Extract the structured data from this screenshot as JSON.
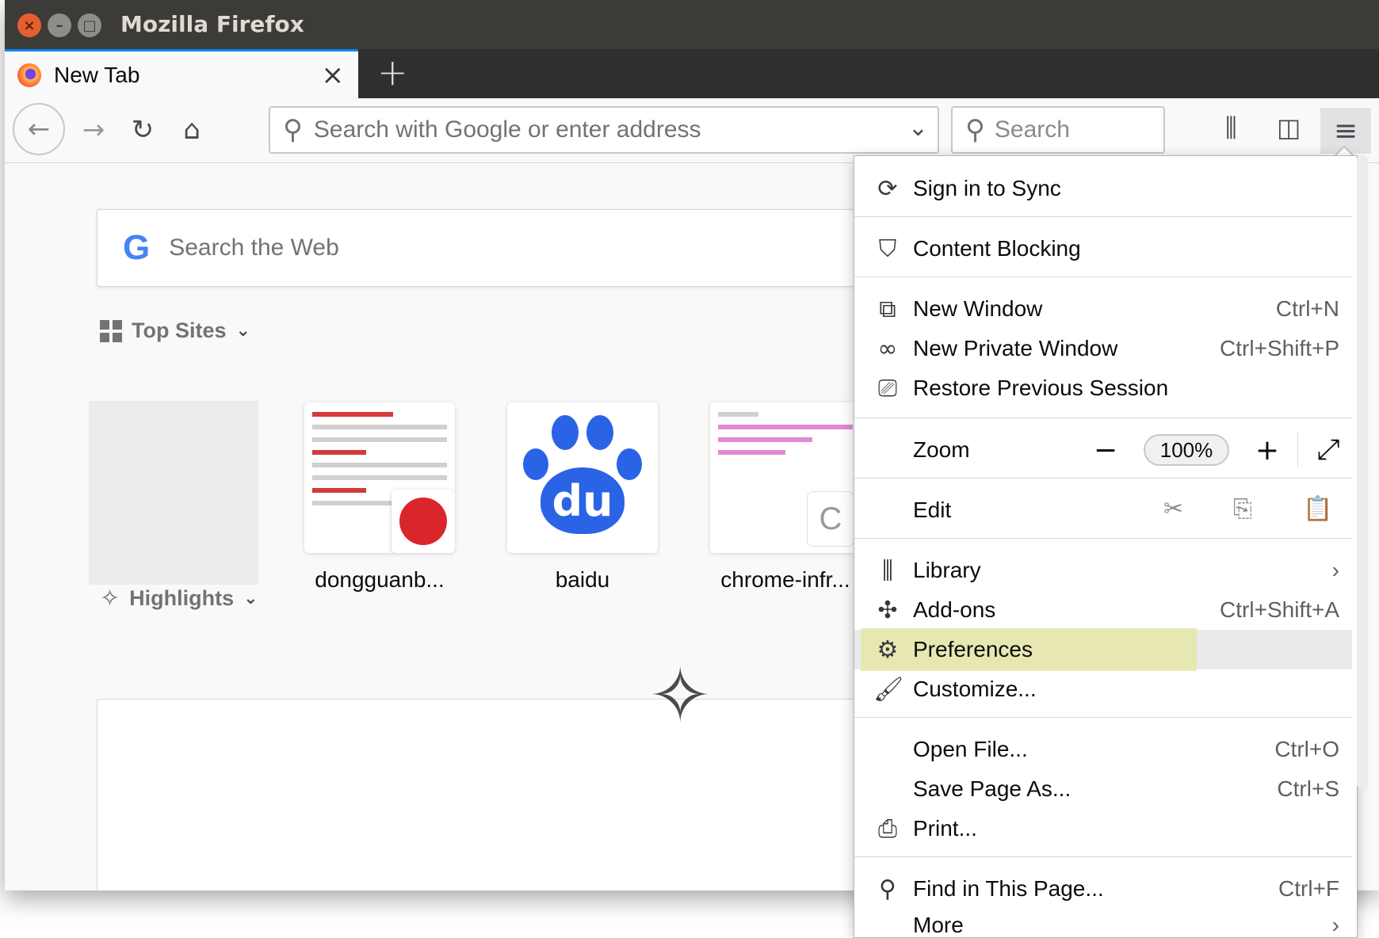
{
  "window": {
    "title": "Mozilla Firefox"
  },
  "tab": {
    "title": "New Tab",
    "close": "×"
  },
  "newtab": "+",
  "navbar": {
    "url_placeholder": "Search with Google or enter address",
    "search_placeholder": "Search"
  },
  "content": {
    "websearch_placeholder": "Search the Web",
    "top_sites_label": "Top Sites",
    "highlights_label": "Highlights",
    "top_sites": [
      {
        "label": ""
      },
      {
        "label": "dongguanb..."
      },
      {
        "label": "baidu"
      },
      {
        "label": "chrome-infr..."
      }
    ],
    "baidu_text": "du",
    "chrome_letter": "C"
  },
  "menu": {
    "sign_in": "Sign in to Sync",
    "content_blocking": "Content Blocking",
    "new_window": {
      "label": "New Window",
      "shortcut": "Ctrl+N"
    },
    "new_private": {
      "label": "New Private Window",
      "shortcut": "Ctrl+Shift+P"
    },
    "restore": "Restore Previous Session",
    "zoom": {
      "label": "Zoom",
      "value": "100%",
      "minus": "−",
      "plus": "+"
    },
    "edit": "Edit",
    "library": "Library",
    "addons": {
      "label": "Add-ons",
      "shortcut": "Ctrl+Shift+A"
    },
    "preferences": "Preferences",
    "customize": "Customize...",
    "open_file": {
      "label": "Open File...",
      "shortcut": "Ctrl+O"
    },
    "save_page": {
      "label": "Save Page As...",
      "shortcut": "Ctrl+S"
    },
    "print": "Print...",
    "find": {
      "label": "Find in This Page...",
      "shortcut": "Ctrl+F"
    },
    "more": "More"
  },
  "colors": {
    "accent": "#0a84ff",
    "highlight": "#e6e6a8",
    "titlebar": "#3c3b37"
  }
}
